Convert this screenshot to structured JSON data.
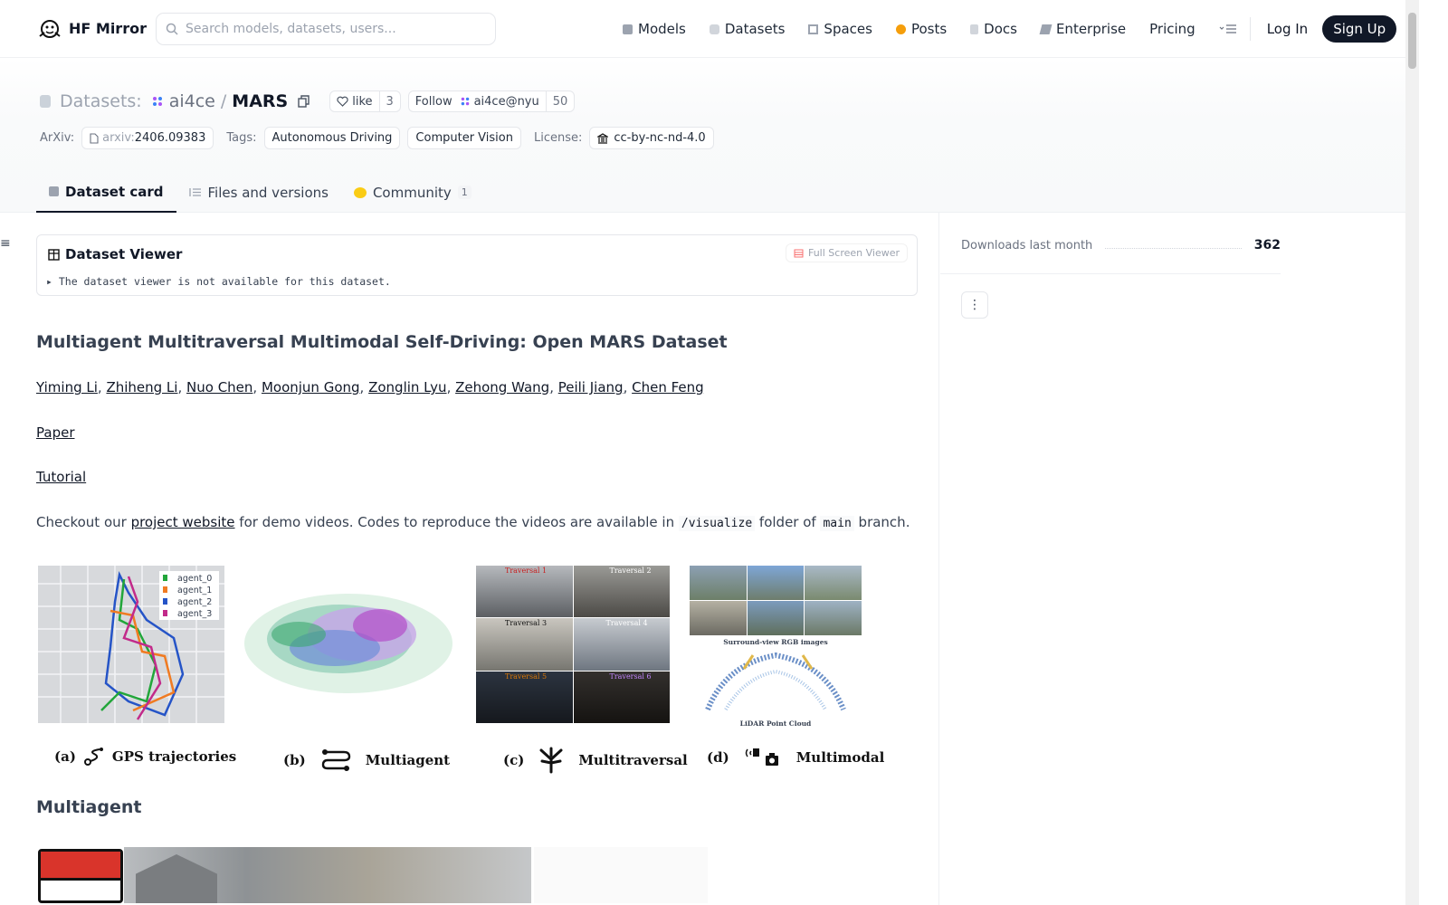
{
  "nav": {
    "brand": "HF Mirror",
    "search_placeholder": "Search models, datasets, users...",
    "links": [
      "Models",
      "Datasets",
      "Spaces",
      "Posts",
      "Docs",
      "Enterprise",
      "Pricing"
    ],
    "login": "Log In",
    "signup": "Sign Up"
  },
  "header": {
    "section": "Datasets:",
    "owner": "ai4ce",
    "separator": "/",
    "repo": "MARS",
    "like_label": "like",
    "like_count": "3",
    "follow_label": "Follow",
    "follow_org": "ai4ce@nyu",
    "follow_count": "50",
    "arxiv_label": "ArXiv:",
    "arxiv_prefix": "arxiv:",
    "arxiv_id": "2406.09383",
    "tags_label": "Tags:",
    "tags": [
      "Autonomous Driving",
      "Computer Vision"
    ],
    "license_label": "License:",
    "license": "cc-by-nc-nd-4.0"
  },
  "tabs": [
    {
      "label": "Dataset card",
      "active": true
    },
    {
      "label": "Files and versions",
      "active": false
    },
    {
      "label": "Community",
      "active": false,
      "badge": "1"
    }
  ],
  "viewer": {
    "title": "Dataset Viewer",
    "fullscreen": "Full Screen Viewer",
    "message": "The dataset viewer is not available for this dataset."
  },
  "card": {
    "title": "Multiagent Multitraversal Multimodal Self-Driving: Open MARS Dataset",
    "authors": [
      "Yiming Li",
      "Zhiheng Li",
      "Nuo Chen",
      "Moonjun Gong",
      "Zonglin Lyu",
      "Zehong Wang",
      "Peili Jiang",
      "Chen Feng"
    ],
    "paper_link": "Paper",
    "tutorial_link": "Tutorial",
    "checkout_prefix": "Checkout our ",
    "checkout_link": "project website",
    "checkout_mid": " for demo videos. Codes to reproduce the videos are available in ",
    "checkout_code1": "/visualize",
    "checkout_mid2": " folder of ",
    "checkout_code2": "main",
    "checkout_suffix": " branch.",
    "figure": {
      "legend": [
        "agent_0",
        "agent_1",
        "agent_2",
        "agent_3"
      ],
      "legend_colors": [
        "#22a63a",
        "#f07b22",
        "#2554c7",
        "#c22a8a"
      ],
      "traversal_labels": [
        "Traversal 1",
        "Traversal 2",
        "Traversal 3",
        "Traversal 4",
        "Traversal 5",
        "Traversal 6"
      ],
      "surround_label": "Surround-view RGB images",
      "lidar_label": "LiDAR Point Cloud",
      "captions": [
        {
          "letter": "(a)",
          "text": "GPS trajectories"
        },
        {
          "letter": "(b)",
          "text": "Multiagent"
        },
        {
          "letter": "(c)",
          "text": "Multitraversal"
        },
        {
          "letter": "(d)",
          "text": "Multimodal"
        }
      ]
    },
    "section2": "Multiagent"
  },
  "sidebar": {
    "downloads_label": "Downloads last month",
    "downloads_value": "362"
  }
}
